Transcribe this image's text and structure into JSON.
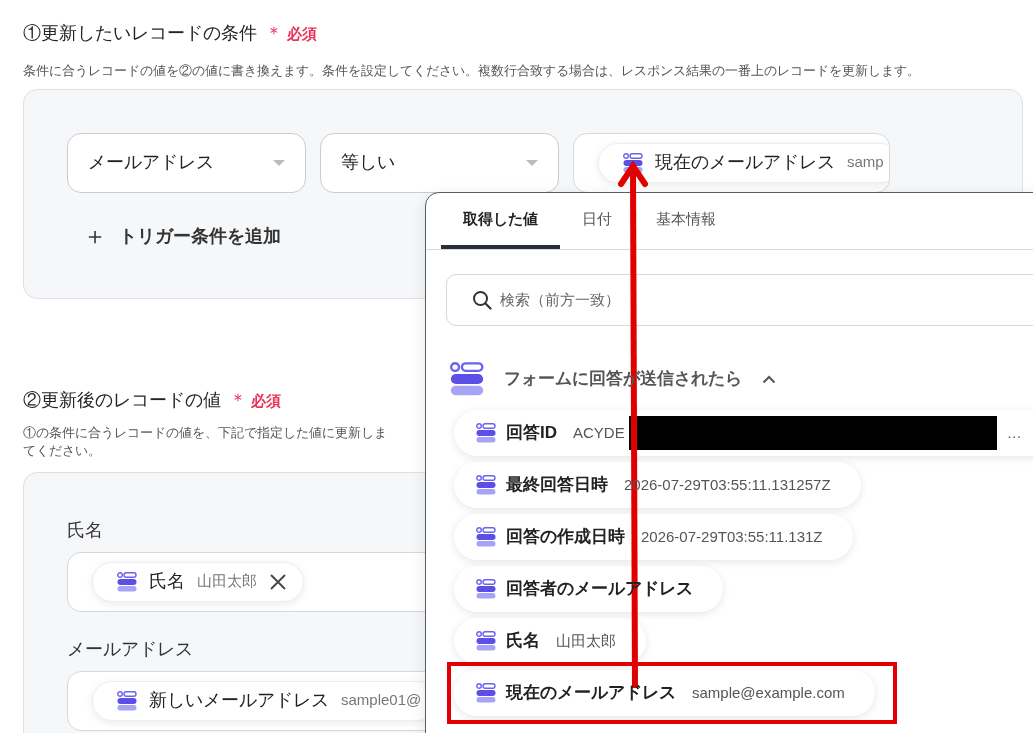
{
  "section1": {
    "title": "①更新したいレコードの条件",
    "required_mark": "＊",
    "required_label": "必須",
    "description": "条件に合うレコードの値を②の値に書き換えます。条件を設定してください。複数行合致する場合は、レスポンス結果の一番上のレコードを更新します。",
    "condition": {
      "field_select": "メールアドレス",
      "operator_select": "等しい",
      "value_chip": {
        "name": "現在のメールアドレス",
        "value": "samp"
      }
    },
    "add_button": {
      "icon": "＋",
      "label": "トリガー条件を追加"
    }
  },
  "section2": {
    "title": "②更新後のレコードの値",
    "required_mark": "＊",
    "required_label": "必須",
    "description_lines": [
      "①の条件に合うレコードの値を、下記で指定した値に更新しま",
      "てください。"
    ],
    "fields": [
      {
        "label": "氏名",
        "chip": {
          "name": "氏名",
          "value": "山田太郎",
          "removable": true
        }
      },
      {
        "label": "メールアドレス",
        "chip": {
          "name": "新しいメールアドレス",
          "value": "sample01@",
          "removable": false
        }
      }
    ]
  },
  "picker": {
    "tabs": [
      {
        "label": "取得した値",
        "selected": true
      },
      {
        "label": "日付",
        "selected": false
      },
      {
        "label": "基本情報",
        "selected": false
      }
    ],
    "search": {
      "placeholder": "検索（前方一致）"
    },
    "group": {
      "label": "フォームに回答が送信されたら",
      "expanded": true
    },
    "items": [
      {
        "name": "回答ID",
        "value": "ACYDE",
        "redacted": true,
        "tail": "…",
        "highlighted": false
      },
      {
        "name": "最終回答日時",
        "value": "2026-07-29T03:55:11.131257Z",
        "redacted": false,
        "highlighted": false
      },
      {
        "name": "回答の作成日時",
        "value": "2026-07-29T03:55:11.131Z",
        "redacted": false,
        "highlighted": false
      },
      {
        "name": "回答者のメールアドレス",
        "redacted": false,
        "highlighted": false
      },
      {
        "name": "氏名",
        "value": "山田太郎",
        "redacted": false,
        "highlighted": false
      },
      {
        "name": "現在のメールアドレス",
        "value": "sample@example.com",
        "redacted": false,
        "highlighted": true
      }
    ]
  },
  "annotation": {
    "arrow": true
  }
}
